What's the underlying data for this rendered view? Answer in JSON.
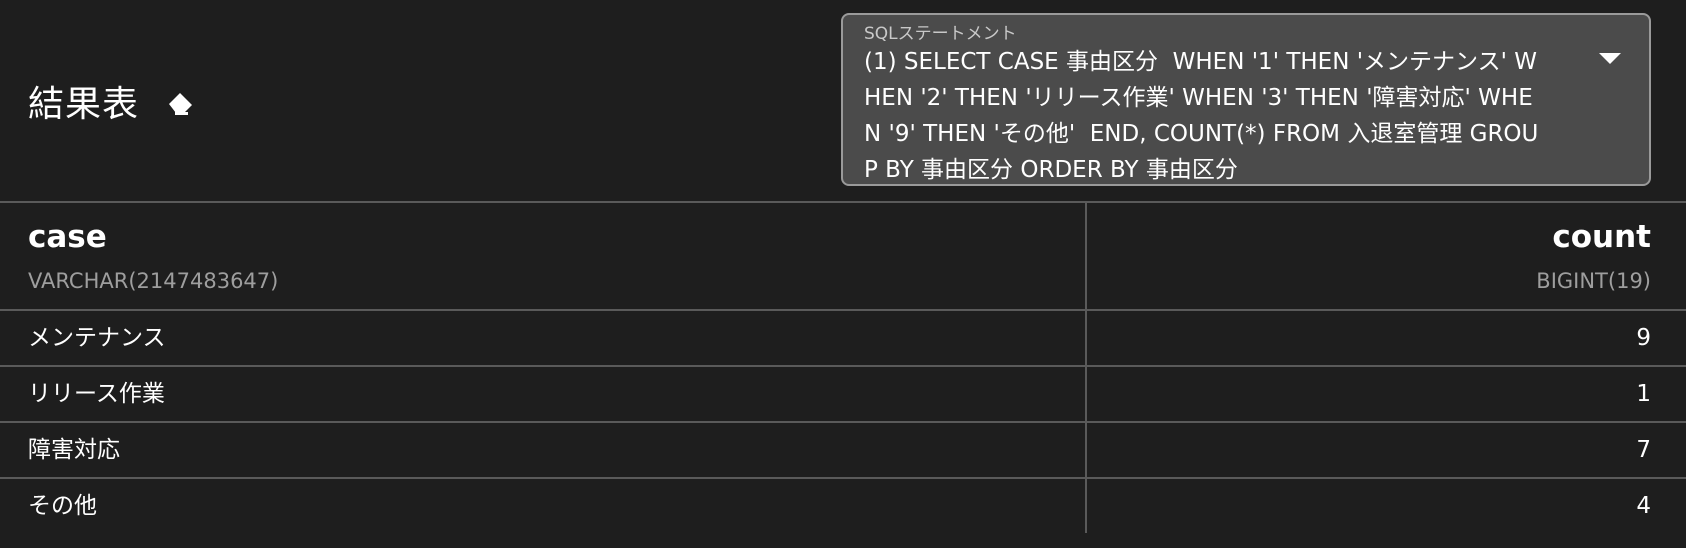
{
  "header": {
    "title": "結果表",
    "eraser_icon": "eraser-icon"
  },
  "sql_statement": {
    "label": "SQLステートメント",
    "selected": "(1) SELECT CASE 事由区分  WHEN '1' THEN 'メンテナンス' WHEN '2' THEN 'リリース作業' WHEN '3' THEN '障害対応' WHEN '9' THEN 'その他'  END, COUNT(*) FROM 入退室管理 GROUP BY 事由区分 ORDER BY 事由区分",
    "dropdown_icon": "chevron-down-icon"
  },
  "table": {
    "columns": [
      {
        "name": "case",
        "type": "VARCHAR(2147483647)"
      },
      {
        "name": "count",
        "type": "BIGINT(19)"
      }
    ],
    "rows": [
      [
        "メンテナンス",
        "9"
      ],
      [
        "リリース作業",
        "1"
      ],
      [
        "障害対応",
        "7"
      ],
      [
        "その他",
        "4"
      ]
    ]
  },
  "colors": {
    "background": "#1e1e1e",
    "select_background": "#4b4b4b",
    "border": "#5a5a5a",
    "muted_text": "#9e9e9e"
  }
}
